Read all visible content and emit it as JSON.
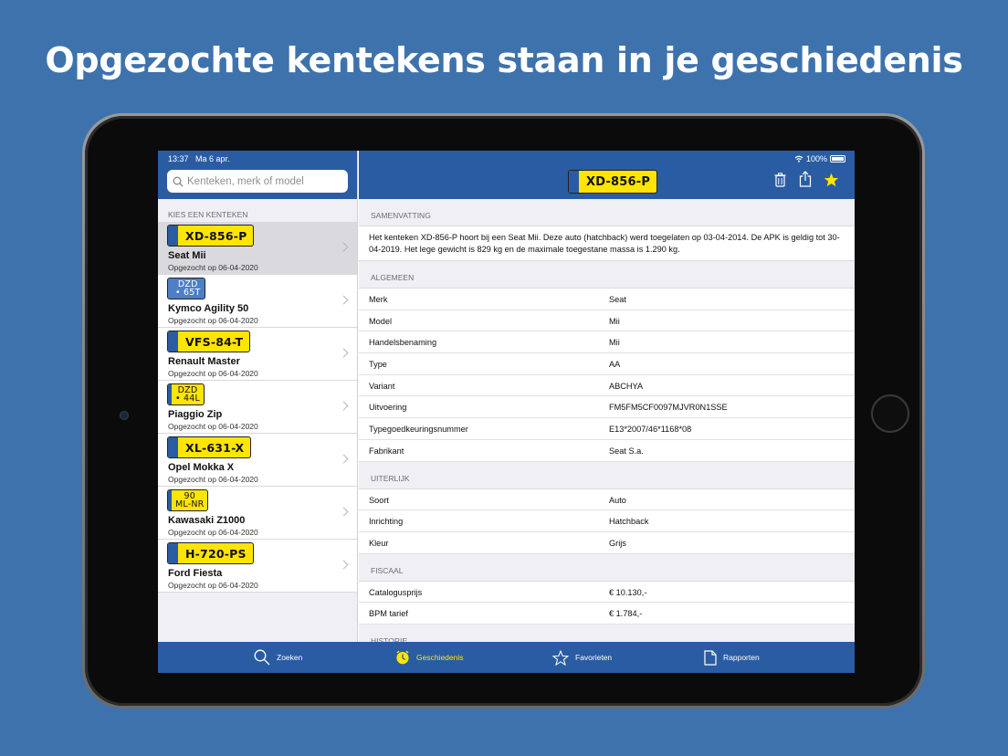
{
  "headline": "Opgezochte kentekens staan in je geschiedenis",
  "status": {
    "time": "13:37",
    "date": "Ma 6 apr.",
    "battery": "100%"
  },
  "search": {
    "placeholder": "Kenteken, merk of model"
  },
  "sidebar": {
    "section": "KIES EEN KENTEKEN",
    "items": [
      {
        "plate": "XD-856-P",
        "name": "Seat Mii",
        "date": "Opgezocht op 06-04-2020"
      },
      {
        "plate_l1": "DZD",
        "plate_l2": "• 65T",
        "name": "Kymco Agility 50",
        "date": "Opgezocht op 06-04-2020"
      },
      {
        "plate": "VFS-84-T",
        "name": "Renault Master",
        "date": "Opgezocht op 06-04-2020"
      },
      {
        "plate_l1": "DZD",
        "plate_l2": "• 44L",
        "name": "Piaggio Zip",
        "date": "Opgezocht op 06-04-2020"
      },
      {
        "plate": "XL-631-X",
        "name": "Opel Mokka X",
        "date": "Opgezocht op 06-04-2020"
      },
      {
        "plate_l1": "90",
        "plate_l2": "ML-NR",
        "name": "Kawasaki Z1000",
        "date": "Opgezocht op 06-04-2020"
      },
      {
        "plate": "H-720-PS",
        "name": "Ford Fiesta",
        "date": "Opgezocht op 06-04-2020"
      }
    ]
  },
  "detail": {
    "plate": "XD-856-P",
    "summary_title": "SAMENVATTING",
    "summary": "Het kenteken XD-856-P hoort bij een Seat Mii. Deze auto (hatchback) werd toegelaten op 03-04-2014. De APK is geldig tot 30-04-2019. Het lege gewicht is 829 kg en de maximale toegestane massa is 1.290 kg.",
    "algemeen": {
      "title": "ALGEMEEN",
      "rows": [
        {
          "k": "Merk",
          "v": "Seat"
        },
        {
          "k": "Model",
          "v": "Mii"
        },
        {
          "k": "Handelsbenaming",
          "v": "Mii"
        },
        {
          "k": "Type",
          "v": "AA"
        },
        {
          "k": "Variant",
          "v": "ABCHYA"
        },
        {
          "k": "Uitvoering",
          "v": "FM5FM5CF0097MJVR0N1SSE"
        },
        {
          "k": "Typegoedkeuringsnummer",
          "v": "E13*2007/46*1168*08"
        },
        {
          "k": "Fabrikant",
          "v": "Seat S.a."
        }
      ]
    },
    "uiterlijk": {
      "title": "UITERLIJK",
      "rows": [
        {
          "k": "Soort",
          "v": "Auto"
        },
        {
          "k": "Inrichting",
          "v": "Hatchback"
        },
        {
          "k": "Kleur",
          "v": "Grijs"
        }
      ]
    },
    "fiscaal": {
      "title": "FISCAAL",
      "rows": [
        {
          "k": "Catalogusprijs",
          "v": "€ 10.130,-"
        },
        {
          "k": "BPM tarief",
          "v": "€ 1.784,-"
        }
      ]
    },
    "historie_title": "HISTORIE"
  },
  "tabs": [
    {
      "label": "Zoeken",
      "icon": "search-icon"
    },
    {
      "label": "Geschiedenis",
      "icon": "clock-icon"
    },
    {
      "label": "Favorieten",
      "icon": "star-icon"
    },
    {
      "label": "Rapporten",
      "icon": "document-icon"
    }
  ],
  "colors": {
    "background": "#3e72ad",
    "bar": "#2a5ca3",
    "plate": "#ffe500",
    "active_tab": "#ffe500"
  }
}
